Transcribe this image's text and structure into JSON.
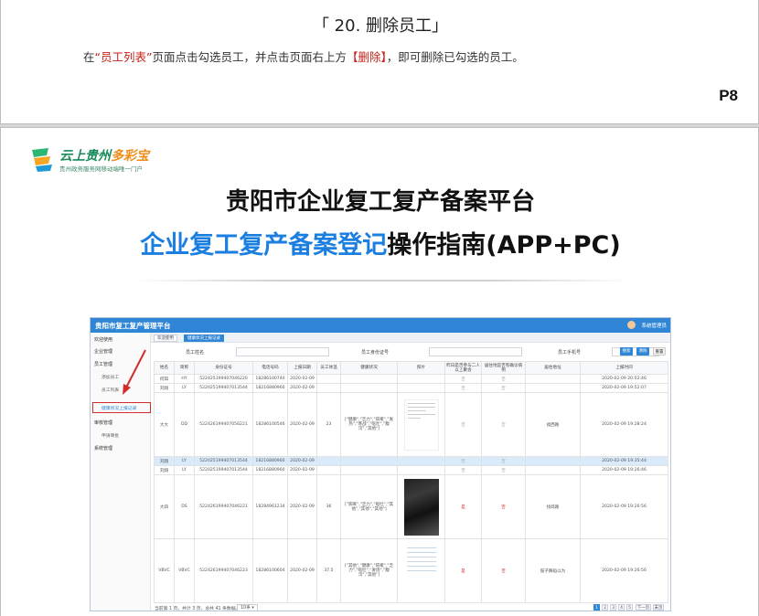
{
  "page1": {
    "title": "「 20. 删除员工」",
    "instr_pre": "在",
    "instr_link1": "“员工列表”",
    "instr_mid": "页面点击勾选员工，并点击页面右上方",
    "instr_link2": "【删除】",
    "instr_post": "，即可删除已勾选的员工。",
    "page_number": "P8"
  },
  "page2": {
    "logo_name_a": "云上贵州",
    "logo_name_b": "多彩宝",
    "logo_sub": "贵州政务服务网移动端唯一门户",
    "heading1": "贵阳市企业复工复产备案平台",
    "heading2_blue": "企业复工复产备案登记",
    "heading2_black": "操作指南(APP+PC)"
  },
  "colors": {
    "accent_blue": "#1a7fe0",
    "highlight_red": "#c8211a",
    "app_bar": "#2f86d6"
  },
  "app": {
    "title": "贵阳市复工复产管理平台",
    "user": "系统管理员",
    "sidebar": {
      "i1": "欢迎使用",
      "i2": "企业管理",
      "i3": "员工管理",
      "s1": "添加员工",
      "s2": "员工列表",
      "s3": "健康状况上报记录",
      "i4": "审核管理",
      "s4": "申请审批",
      "i5": "系统管理"
    },
    "tabs": {
      "t1": "欢迎使用",
      "t2": "健康状况上报记录"
    },
    "filters": {
      "f1": "员工姓名",
      "f2": "员工身份证号",
      "f3": "员工手机号",
      "search": "搜索",
      "clear": "清除",
      "reset": "重置"
    },
    "columns": [
      "姓名",
      "简称",
      "身份证号",
      "电话号码",
      "上报日期",
      "员工体温",
      "健康状况",
      "照片",
      "昨日是否参与二人以上聚会",
      "居住地是否有确诊病例",
      "居住地址",
      "上报时间"
    ],
    "rows": [
      {
        "name": "何琪",
        "abbr": "HY",
        "id": "522425199407046220",
        "phone": "18286100740",
        "date": "2020-02-09",
        "temp": "",
        "health": "",
        "pa": "否",
        "pb": "否",
        "addr": "",
        "time": "2020-02-09 20:02:46"
      },
      {
        "name": "刘翔",
        "abbr": "LY",
        "id": "522025199407013544",
        "phone": "18216880960",
        "date": "2020-02-09",
        "temp": "",
        "health": "",
        "pa": "否",
        "pb": "否",
        "addr": "",
        "time": "2020-02-09 19:52:07"
      },
      {
        "name": "大大",
        "abbr": "DD",
        "id": "522426199407056221",
        "phone": "18286100546",
        "date": "2020-02-09",
        "temp": "23",
        "health": "[\"健康\",\"乏力\",\"咳嗽\",\"发热\",\"寒战\",\"呕吐\",\"腹泻\",\"其他\"]",
        "pa": "否",
        "pb": "否",
        "addr": "福西路",
        "time": "2020-02-09 19:28:24"
      },
      {
        "name": "刘翔",
        "abbr": "LY",
        "id": "522025199407013544",
        "phone": "18216880960",
        "date": "2020-02-09",
        "temp": "",
        "health": "",
        "pa": "否",
        "pb": "否",
        "addr": "",
        "time": "2020-02-09 19:35:44"
      },
      {
        "name": "刘翔",
        "abbr": "LY",
        "id": "522025199407013544",
        "phone": "18216880960",
        "date": "2020-02-09",
        "temp": "",
        "health": "",
        "pa": "否",
        "pb": "否",
        "addr": "",
        "time": "2020-02-09 19:26:46"
      },
      {
        "name": "大四",
        "abbr": "DS",
        "id": "522426199407046221",
        "phone": "18284961234",
        "date": "2020-02-09",
        "temp": "36",
        "health": "[\"咳嗽\",\"乏力\",\"呕吐\",\"其他\",\"其他\",\"其他\"]",
        "pa": "是",
        "pb": "否",
        "addr": "找碎路",
        "time": "2020-02-09 19:26:56"
      },
      {
        "name": "VBVC",
        "abbr": "VBVC",
        "id": "522426199407046223",
        "phone": "18286100604",
        "date": "2020-02-09",
        "temp": "37.5",
        "health": "[\"其他\",\"健康\",\"咳嗽\",\"乏力\",\"呕吐\",\"发烧\",\"腹泻\",\"其他\"]",
        "pa": "是",
        "pb": "否",
        "addr": "鼓子舞蹈以为",
        "time": "2020-02-09 19:26:56"
      }
    ],
    "footer": {
      "summary": "当前第 1 页，共计 3 页，总共 41 条数据。",
      "pagesize": "10条 ▾",
      "next": "下一页",
      "last": "末页",
      "p1": "1",
      "p2": "2",
      "p3": "3",
      "p4": "4",
      "p5": "5"
    }
  }
}
